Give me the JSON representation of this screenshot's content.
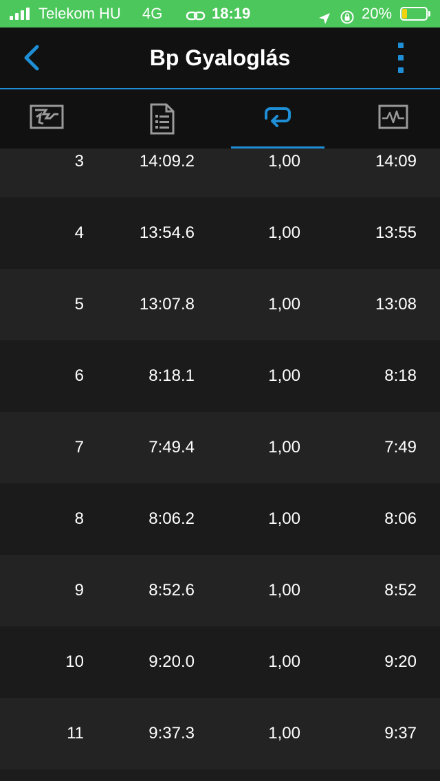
{
  "status_bar": {
    "carrier": "Telekom HU",
    "network": "4G",
    "time": "18:19",
    "battery_percent": "20%",
    "battery_level": 0.2,
    "background_color": "#4cc75c"
  },
  "nav": {
    "title": "Bp Gyaloglás",
    "back_icon": "chevron-left-icon",
    "menu_icon": "more-vertical-icon",
    "accent_color": "#1e8fd6"
  },
  "tabs": [
    {
      "icon": "map-icon",
      "active": false
    },
    {
      "icon": "document-list-icon",
      "active": false
    },
    {
      "icon": "laps-loop-icon",
      "active": true
    },
    {
      "icon": "activity-chart-icon",
      "active": false
    }
  ],
  "laps": [
    {
      "lap": "3",
      "time": "14:09.2",
      "distance": "1,00",
      "pace": "14:09"
    },
    {
      "lap": "4",
      "time": "13:54.6",
      "distance": "1,00",
      "pace": "13:55"
    },
    {
      "lap": "5",
      "time": "13:07.8",
      "distance": "1,00",
      "pace": "13:08"
    },
    {
      "lap": "6",
      "time": "8:18.1",
      "distance": "1,00",
      "pace": "8:18"
    },
    {
      "lap": "7",
      "time": "7:49.4",
      "distance": "1,00",
      "pace": "7:49"
    },
    {
      "lap": "8",
      "time": "8:06.2",
      "distance": "1,00",
      "pace": "8:06"
    },
    {
      "lap": "9",
      "time": "8:52.6",
      "distance": "1,00",
      "pace": "8:52"
    },
    {
      "lap": "10",
      "time": "9:20.0",
      "distance": "1,00",
      "pace": "9:20"
    },
    {
      "lap": "11",
      "time": "9:37.3",
      "distance": "1,00",
      "pace": "9:37"
    }
  ]
}
